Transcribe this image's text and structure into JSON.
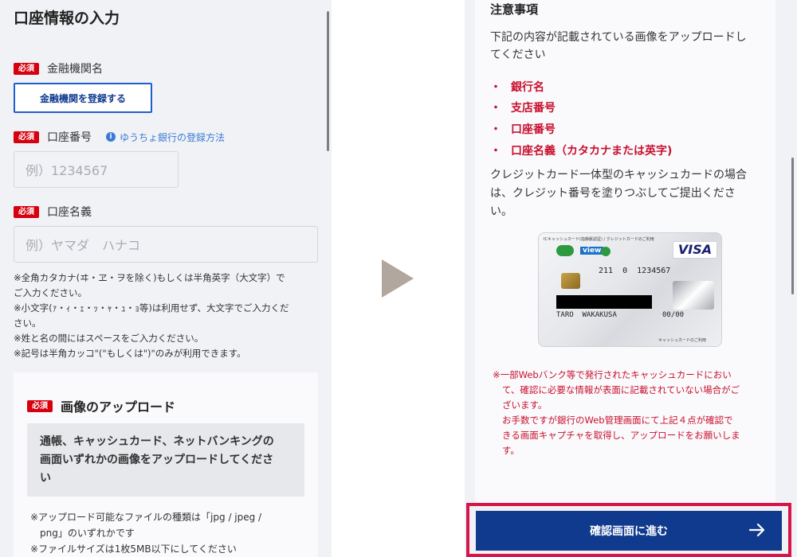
{
  "left": {
    "section_title": "口座情報の入力",
    "required_badge": "必須",
    "bank": {
      "label": "金融機関名",
      "button": "金融機関を登録する"
    },
    "account_number": {
      "label": "口座番号",
      "help_link": "ゆうちょ銀行の登録方法",
      "placeholder": "例）1234567"
    },
    "account_name": {
      "label": "口座名義",
      "placeholder": "例）ヤマダ　ハナコ"
    },
    "notes": [
      "※全角カタカナ(ヰ・ヱ・ヲを除く)もしくは半角英字（大文字）で",
      "ご入力ください。",
      "※小文字(ｧ・ｨ・ｪ・ｯ・ｬ・ｭ・ｮ等)は利用せず、大文字でご入力くだ",
      "さい。",
      "※姓と名の間にはスペースをご入力ください。",
      "※記号は半角カッコ\"(\"もしくは\")\"のみが利用できます。"
    ],
    "upload": {
      "title": "画像のアップロード",
      "instruction": [
        "通帳、キャッシュカード、ネットバンキングの",
        "画面いずれかの画像をアップロードしてくださ",
        "い"
      ],
      "notes": [
        "※アップロード可能なファイルの種類は「jpg / jpeg /",
        "png」のいずれかです",
        "※ファイルサイズは1枚5MB以下にしてください"
      ]
    }
  },
  "right": {
    "notice_title": "注意事項",
    "intro": [
      "下記の内容が記載されている画像をアップロードし",
      "てください"
    ],
    "bullets": [
      "銀行名",
      "支店番号",
      "口座番号",
      "口座名義（カタカナまたは英字)"
    ],
    "cc_note": [
      "クレジットカード一体型のキャッシュカードの場合",
      "は、クレジット番号を塗りつぶしてご提出くださ",
      "い。"
    ],
    "card": {
      "header": "ICキャッシュカード(指静脈認証) / クレジットカードのご利用",
      "brand": "VISA",
      "view": "view",
      "number": "211  0  1234567",
      "holder": "TARO  WAKAKUSA",
      "expiry": "00/00",
      "footer": "キャッシュカードのご利用"
    },
    "red_notes": [
      "※一部Webバンク等で発行されたキャッシュカードにおい",
      "て、確認に必要な情報が表面に記載されていない場合がご",
      "ざいます。",
      "お手数ですが銀行のWeb管理画面にて上記４点が確認で",
      "きる画面キャプチャを取得し、アップロードをお願いしま",
      "す。"
    ],
    "cta_label": "確認画面に進む"
  },
  "colors": {
    "accent_red": "#d7000f",
    "cta_blue": "#103a8e",
    "highlight": "#d6154a",
    "link_blue": "#3a7bd5"
  }
}
